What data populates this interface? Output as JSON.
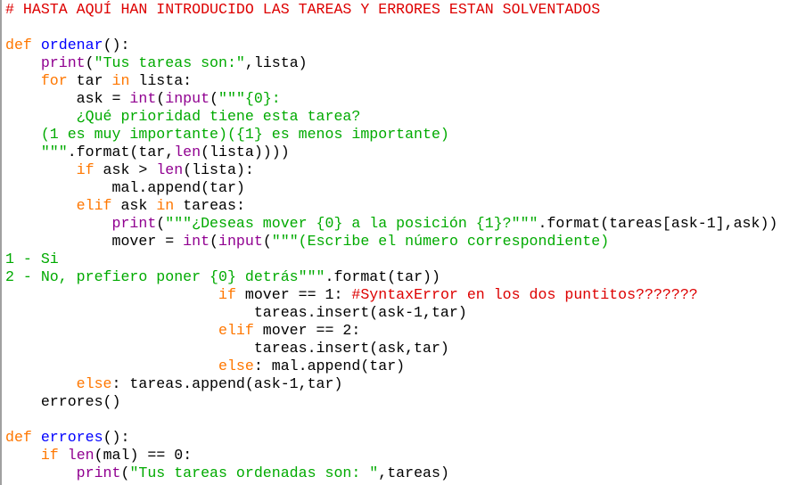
{
  "editor": {
    "theme": {
      "keyword": "#ff7700",
      "builtin": "#900090",
      "string": "#00aa00",
      "comment": "#dd0000",
      "definition": "#0000ff",
      "default": "#000000",
      "background": "#ffffff"
    },
    "lines": [
      [
        [
          "comment",
          "# HASTA AQUÍ HAN INTRODUCIDO LAS TAREAS Y ERRORES ESTAN SOLVENTADOS"
        ]
      ],
      [],
      [
        [
          "keyword",
          "def"
        ],
        [
          "default",
          " "
        ],
        [
          "definition",
          "ordenar"
        ],
        [
          "default",
          "():"
        ]
      ],
      [
        [
          "default",
          "    "
        ],
        [
          "builtin",
          "print"
        ],
        [
          "default",
          "("
        ],
        [
          "string",
          "\"Tus tareas son:\""
        ],
        [
          "default",
          ",lista)"
        ]
      ],
      [
        [
          "default",
          "    "
        ],
        [
          "keyword",
          "for"
        ],
        [
          "default",
          " tar "
        ],
        [
          "keyword",
          "in"
        ],
        [
          "default",
          " lista:"
        ]
      ],
      [
        [
          "default",
          "        ask = "
        ],
        [
          "builtin",
          "int"
        ],
        [
          "default",
          "("
        ],
        [
          "builtin",
          "input"
        ],
        [
          "default",
          "("
        ],
        [
          "string",
          "\"\"\"{0}:"
        ]
      ],
      [
        [
          "string",
          "        ¿Qué prioridad tiene esta tarea?"
        ]
      ],
      [
        [
          "string",
          "    (1 es muy importante)({1} es menos importante)"
        ]
      ],
      [
        [
          "string",
          "    \"\"\""
        ],
        [
          "default",
          ".format(tar,"
        ],
        [
          "builtin",
          "len"
        ],
        [
          "default",
          "(lista))))"
        ]
      ],
      [
        [
          "default",
          "        "
        ],
        [
          "keyword",
          "if"
        ],
        [
          "default",
          " ask > "
        ],
        [
          "builtin",
          "len"
        ],
        [
          "default",
          "(lista):"
        ]
      ],
      [
        [
          "default",
          "            mal.append(tar)"
        ]
      ],
      [
        [
          "default",
          "        "
        ],
        [
          "keyword",
          "elif"
        ],
        [
          "default",
          " ask "
        ],
        [
          "keyword",
          "in"
        ],
        [
          "default",
          " tareas:"
        ]
      ],
      [
        [
          "default",
          "            "
        ],
        [
          "builtin",
          "print"
        ],
        [
          "default",
          "("
        ],
        [
          "string",
          "\"\"\"¿Deseas mover {0} a la posición {1}?\"\"\""
        ],
        [
          "default",
          ".format(tareas[ask-1],ask))"
        ]
      ],
      [
        [
          "default",
          "            mover = "
        ],
        [
          "builtin",
          "int"
        ],
        [
          "default",
          "("
        ],
        [
          "builtin",
          "input"
        ],
        [
          "default",
          "("
        ],
        [
          "string",
          "\"\"\"(Escribe el número correspondiente)"
        ]
      ],
      [
        [
          "string",
          "1 - Si"
        ]
      ],
      [
        [
          "string",
          "2 - No, prefiero poner {0} detrás\"\"\""
        ],
        [
          "default",
          ".format(tar))"
        ]
      ],
      [
        [
          "default",
          "                        "
        ],
        [
          "keyword",
          "if"
        ],
        [
          "default",
          " mover == 1: "
        ],
        [
          "comment",
          "#SyntaxError en los dos puntitos???????"
        ]
      ],
      [
        [
          "default",
          "                            tareas.insert(ask-1,tar)"
        ]
      ],
      [
        [
          "default",
          "                        "
        ],
        [
          "keyword",
          "elif"
        ],
        [
          "default",
          " mover == 2:"
        ]
      ],
      [
        [
          "default",
          "                            tareas.insert(ask,tar)"
        ]
      ],
      [
        [
          "default",
          "                        "
        ],
        [
          "keyword",
          "else"
        ],
        [
          "default",
          ": mal.append(tar)"
        ]
      ],
      [
        [
          "default",
          "        "
        ],
        [
          "keyword",
          "else"
        ],
        [
          "default",
          ": tareas.append(ask-1,tar)"
        ]
      ],
      [
        [
          "default",
          "    errores()"
        ]
      ],
      [],
      [
        [
          "keyword",
          "def"
        ],
        [
          "default",
          " "
        ],
        [
          "definition",
          "errores"
        ],
        [
          "default",
          "():"
        ]
      ],
      [
        [
          "default",
          "    "
        ],
        [
          "keyword",
          "if"
        ],
        [
          "default",
          " "
        ],
        [
          "builtin",
          "len"
        ],
        [
          "default",
          "(mal) == 0:"
        ]
      ],
      [
        [
          "default",
          "        "
        ],
        [
          "builtin",
          "print"
        ],
        [
          "default",
          "("
        ],
        [
          "string",
          "\"Tus tareas ordenadas son: \""
        ],
        [
          "default",
          ",tareas)"
        ]
      ]
    ]
  }
}
